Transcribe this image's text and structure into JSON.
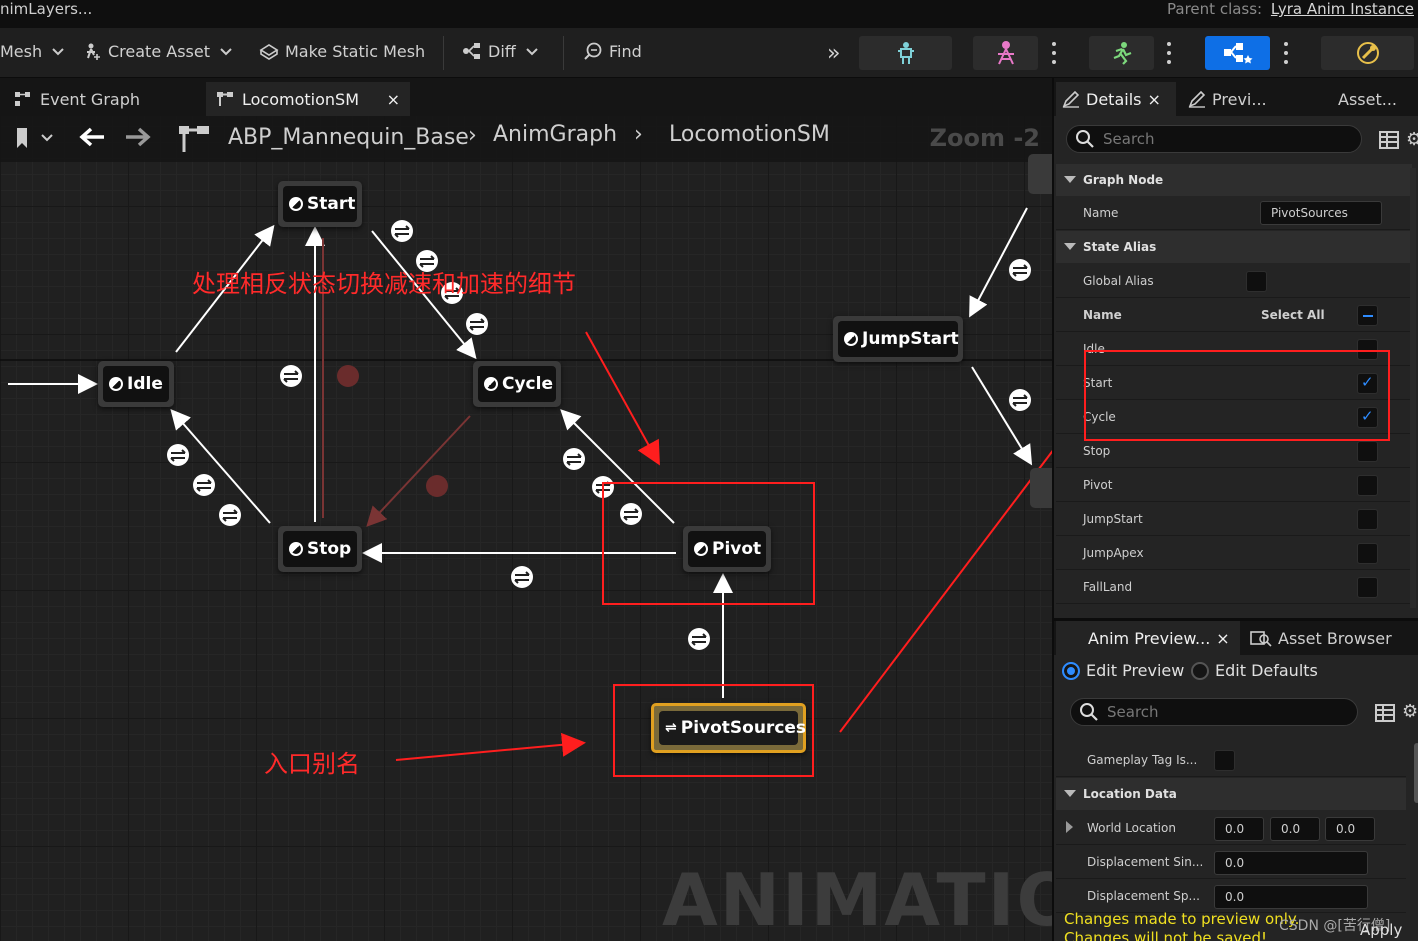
{
  "titlebar": {
    "left": "nimLayers...",
    "parent_label": "Parent class:",
    "parent_value": "Lyra Anim Instance"
  },
  "toolbar": {
    "mesh": "Mesh",
    "create_asset": "Create Asset",
    "make_static_mesh": "Make Static Mesh",
    "diff": "Diff",
    "find": "Find"
  },
  "graph": {
    "tabs": [
      {
        "label": "Event Graph"
      },
      {
        "label": "LocomotionSM"
      }
    ],
    "breadcrumb": [
      "ABP_Mannequin_Base",
      "AnimGraph",
      "LocomotionSM"
    ],
    "zoom": "Zoom -2",
    "nodes": {
      "start": "Start",
      "idle": "Idle",
      "cycle": "Cycle",
      "stop": "Stop",
      "pivot": "Pivot",
      "jumpstart": "JumpStart",
      "pivotsources": "PivotSources"
    },
    "annotations": {
      "top": "处理相反状态切换减速和加速的细节",
      "bottom": "入口别名"
    },
    "watermark": "ANIMATION"
  },
  "details": {
    "tabs": [
      {
        "label": "Details"
      },
      {
        "label": "Previ..."
      },
      {
        "label": "Asset..."
      }
    ],
    "search_placeholder": "Search",
    "graph_node_section": "Graph Node",
    "name_label": "Name",
    "name_value": "PivotSources",
    "state_alias_section": "State Alias",
    "global_alias_label": "Global Alias",
    "global_alias_checked": false,
    "states_header": {
      "name": "Name",
      "select_all": "Select All"
    },
    "states": [
      {
        "label": "Idle",
        "checked": false
      },
      {
        "label": "Start",
        "checked": true
      },
      {
        "label": "Cycle",
        "checked": true
      },
      {
        "label": "Stop",
        "checked": false
      },
      {
        "label": "Pivot",
        "checked": false
      },
      {
        "label": "JumpStart",
        "checked": false
      },
      {
        "label": "JumpApex",
        "checked": false
      },
      {
        "label": "FallLand",
        "checked": false
      }
    ]
  },
  "anim_preview": {
    "tabs": [
      {
        "label": "Anim Preview..."
      },
      {
        "label": "Asset Browser"
      }
    ],
    "radio_edit_preview": "Edit Preview",
    "radio_edit_defaults": "Edit Defaults",
    "search_placeholder": "Search",
    "gameplay_tag_label": "Gameplay Tag Is...",
    "location_section": "Location Data",
    "world_location_label": "World Location",
    "world_location": [
      "0.0",
      "0.0",
      "0.0"
    ],
    "disp_sin_label": "Displacement Sin...",
    "disp_sin_value": "0.0",
    "disp_sp_label": "Displacement Sp...",
    "disp_sp_value": "0.0",
    "warning_1": "Changes made to preview only.",
    "warning_2": "Changes will not be saved!",
    "apply": "Apply",
    "csdn": "CSDN @[苦行僧]"
  },
  "colors": {
    "accent_blue": "#0e6fe6",
    "annotation_red": "#ff1e1e",
    "alias_border": "#e0a020",
    "warning_yellow": "#f0e020"
  }
}
